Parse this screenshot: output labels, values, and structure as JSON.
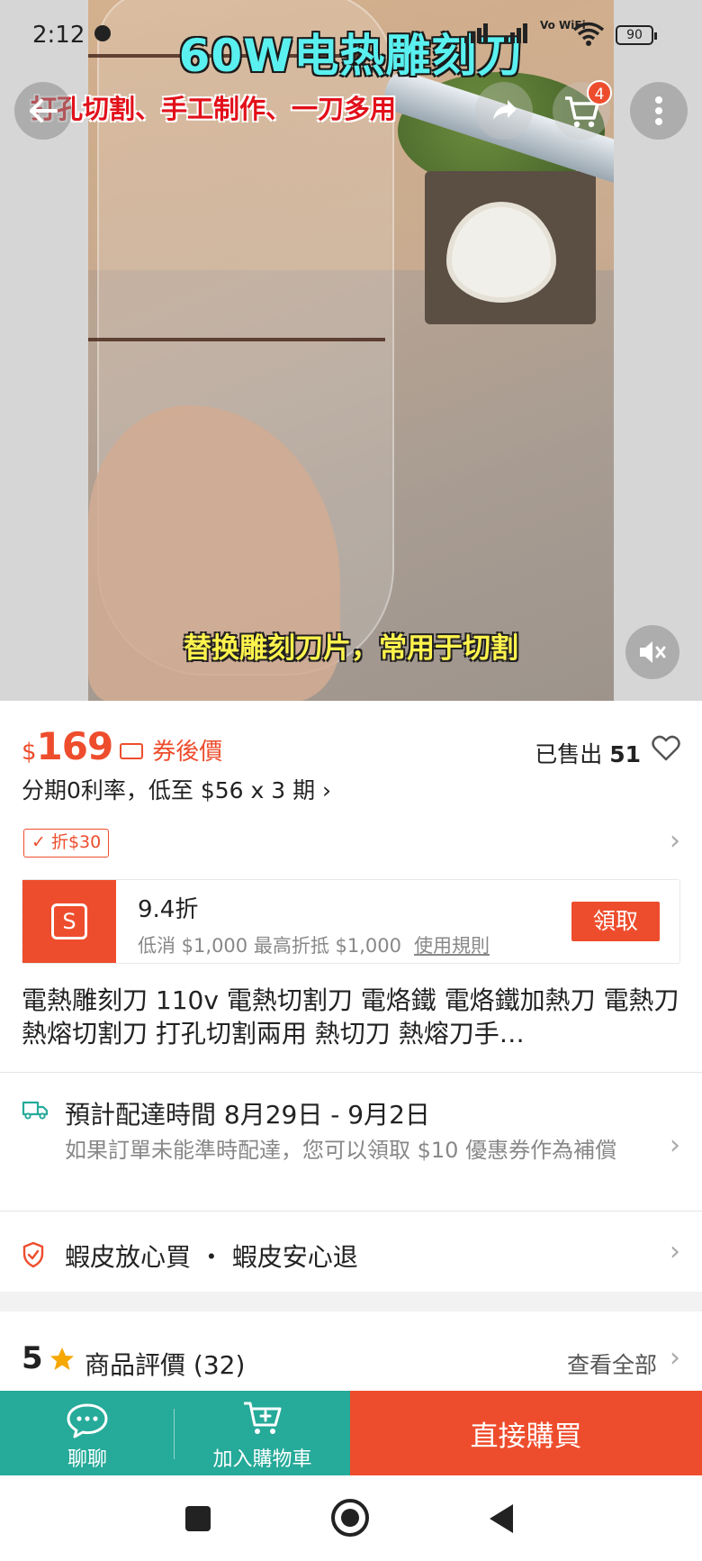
{
  "status_bar": {
    "time": "2:12",
    "network_label": "Vo WiFi",
    "battery": "90"
  },
  "video": {
    "title": "60W电热雕刻刀",
    "subtitle": "打孔切割、手工制作、一刀多用",
    "caption": "替换雕刻刀片，常用于切割",
    "muted": true
  },
  "top_actions": {
    "cart_count": "4"
  },
  "price": {
    "currency": "$",
    "value": "169",
    "tag": "券後價",
    "sold_label": "已售出",
    "sold_count": "51",
    "installment": "分期0利率，低至 $56 x 3 期 ›"
  },
  "discount_tag": "折$30",
  "voucher": {
    "rate": "9.4折",
    "desc": "低消 $1,000 最高折抵 $1,000",
    "rule_link": "使用規則",
    "claim_label": "領取"
  },
  "product_title": "電熱雕刻刀 110v 電熱切割刀 電烙鐵 電烙鐵加熱刀 電熱刀 熱熔切割刀 打孔切割兩用 熱切刀 熱熔刀手…",
  "delivery": {
    "title": "預計配達時間 8月29日 - 9月2日",
    "note": "如果訂單未能準時配達，您可以領取 $10 優惠券作為補償"
  },
  "guarantee": {
    "text": "蝦皮放心買 ・ 蝦皮安心退"
  },
  "rating": {
    "score": "5",
    "label": "商品評價 (32)",
    "see_all": "查看全部"
  },
  "action_bar": {
    "chat_label": "聊聊",
    "add_cart_label": "加入購物車",
    "buy_now_label": "直接購買"
  },
  "colors": {
    "accent": "#ee4d2d",
    "teal": "#26aa99"
  }
}
